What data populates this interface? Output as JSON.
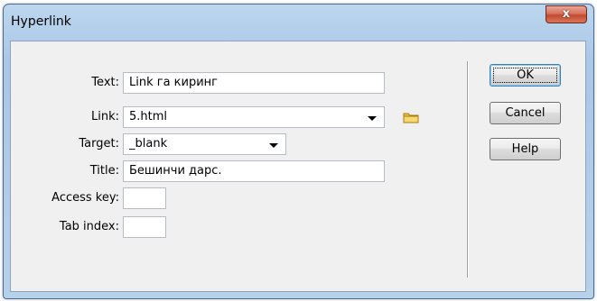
{
  "window": {
    "title": "Hyperlink",
    "close_glyph": "x"
  },
  "form": {
    "text": {
      "label": "Text:",
      "value": "Link га киринг"
    },
    "link": {
      "label": "Link:",
      "value": "5.html",
      "browse_icon": "folder-icon"
    },
    "target": {
      "label": "Target:",
      "value": "_blank"
    },
    "title": {
      "label": "Title:",
      "value": "Бешинчи дарс."
    },
    "access_key": {
      "label": "Access key:",
      "value": ""
    },
    "tab_index": {
      "label": "Tab index:",
      "value": ""
    }
  },
  "buttons": {
    "ok": "OK",
    "cancel": "Cancel",
    "help": "Help"
  },
  "colors": {
    "close_button": "#c14a30",
    "titlebar": "#b7d1ea",
    "client": "#f0f0f0"
  }
}
